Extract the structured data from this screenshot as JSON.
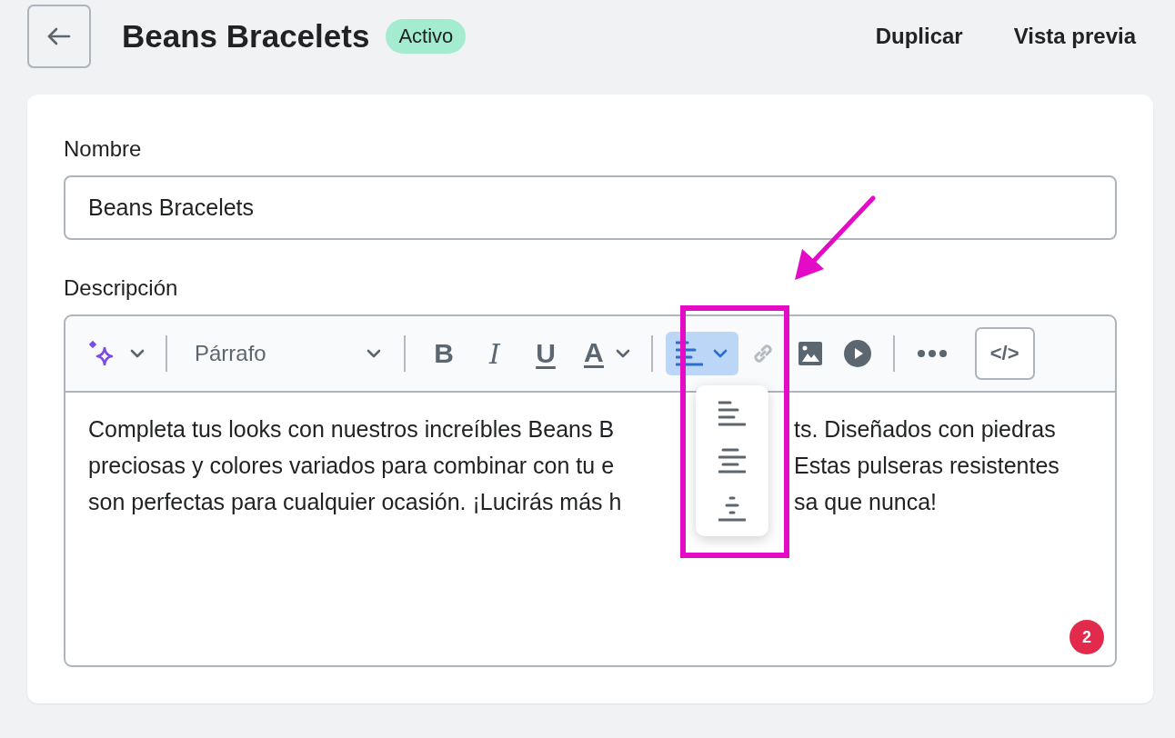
{
  "header": {
    "title": "Beans Bracelets",
    "status": "Activo",
    "actions": [
      "Duplicar",
      "Vista previa"
    ]
  },
  "form": {
    "name_label": "Nombre",
    "name_value": "Beans Bracelets",
    "description_label": "Descripción"
  },
  "toolbar": {
    "groups": [
      [
        {
          "kind": "ai",
          "disabled": false,
          "expanded": false
        }
      ],
      [
        {
          "kind": "select",
          "label": "Párrafo",
          "disabled": false,
          "expanded": false
        }
      ],
      [
        {
          "kind": "bold",
          "glyph": "B",
          "disabled": false,
          "expanded": false
        },
        {
          "kind": "italic",
          "glyph": "I",
          "disabled": false,
          "expanded": false
        },
        {
          "kind": "underline",
          "glyph": "U",
          "disabled": false,
          "expanded": false
        },
        {
          "kind": "color",
          "glyph": "A",
          "disabled": false,
          "expanded": false
        }
      ],
      [
        {
          "kind": "align",
          "disabled": false,
          "expanded": true
        },
        {
          "kind": "link",
          "disabled": true,
          "expanded": false
        },
        {
          "kind": "image",
          "disabled": false,
          "expanded": false
        },
        {
          "kind": "video",
          "disabled": false,
          "expanded": false
        }
      ],
      [
        {
          "kind": "more",
          "disabled": false,
          "expanded": false
        },
        {
          "kind": "code",
          "glyph": "</>",
          "disabled": false,
          "expanded": false
        }
      ]
    ]
  },
  "align_menu": {
    "options": [
      {
        "kind": "left"
      },
      {
        "kind": "center"
      },
      {
        "kind": "right"
      }
    ]
  },
  "description_lines": [
    {
      "left": "Completa tus looks con nuestros increíbles Beans B",
      "right": "ts. Diseñados con piedras"
    },
    {
      "left": "preciosas y colores variados para combinar con tu e",
      "right": "Estas pulseras resistentes"
    },
    {
      "left": "son perfectas para cualquier ocasión. ¡Lucirás más h",
      "right": "sa que nunca!"
    }
  ],
  "notification_count": "2"
}
